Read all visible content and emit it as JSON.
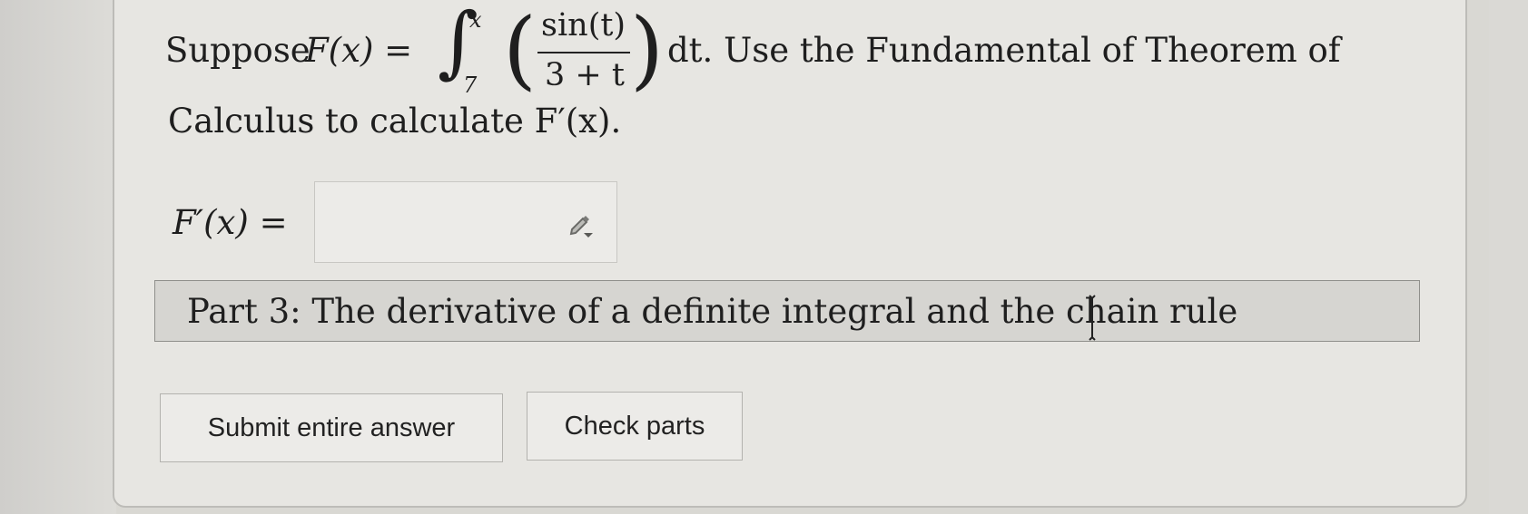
{
  "question": {
    "line1_prefix": "Suppose ",
    "function_name": "F(x) =",
    "integral_upper": "x",
    "integral_lower": "7",
    "numerator": "sin(t)",
    "denominator": "3 + t",
    "line1_suffix": "dt. Use the Fundamental of Theorem of",
    "line2": "Calculus to calculate F′(x)."
  },
  "answer": {
    "label": "F′(x) =",
    "value": "",
    "icon": "pencil-icon"
  },
  "part": {
    "title": "Part 3: The derivative of a definite integral and the chain rule"
  },
  "buttons": {
    "submit": "Submit entire answer",
    "check": "Check parts"
  },
  "colors": {
    "background": "#d9d8d3",
    "card": "#e7e6e2",
    "part_bar": "#d6d5d1",
    "text": "#1f1f1f"
  }
}
